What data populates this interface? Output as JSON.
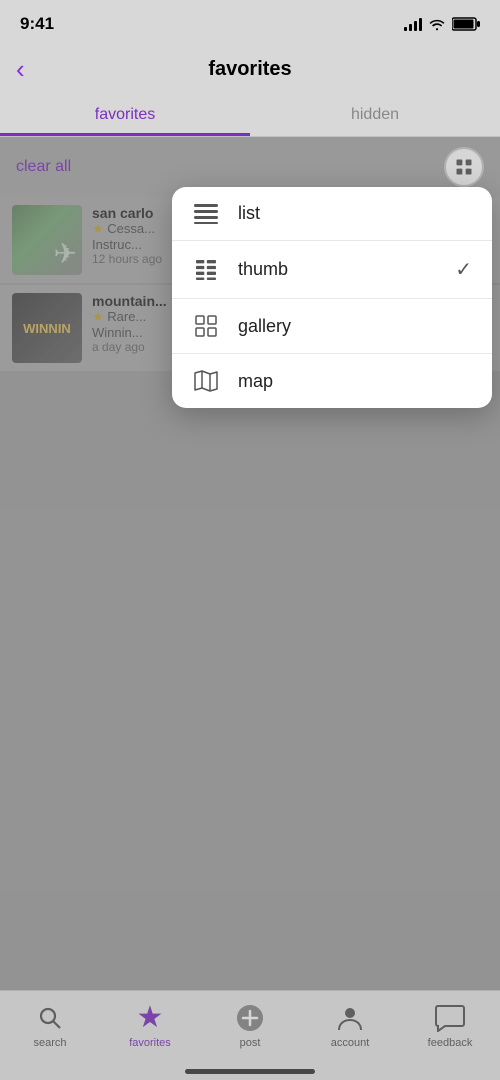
{
  "statusBar": {
    "time": "9:41"
  },
  "header": {
    "backLabel": "‹",
    "title": "favorites"
  },
  "tabs": [
    {
      "id": "favorites",
      "label": "favorites",
      "active": true
    },
    {
      "id": "hidden",
      "label": "hidden",
      "active": false
    }
  ],
  "toolbar": {
    "clearAllLabel": "clear all"
  },
  "listings": [
    {
      "id": 1,
      "title": "san carlo",
      "rating": "★",
      "subtitle": "Cessa...",
      "detail": "Instruc...",
      "time": "12 hours ago",
      "type": "plane"
    },
    {
      "id": 2,
      "title": "mountain...",
      "rating": "★",
      "subtitle": "Rare...",
      "detail": "Winnin...",
      "time": "a day ago",
      "type": "book"
    }
  ],
  "dropdownMenu": {
    "items": [
      {
        "id": "list",
        "label": "list",
        "icon": "list-icon",
        "checked": false
      },
      {
        "id": "thumb",
        "label": "thumb",
        "icon": "thumb-icon",
        "checked": true
      },
      {
        "id": "gallery",
        "label": "gallery",
        "icon": "gallery-icon",
        "checked": false
      },
      {
        "id": "map",
        "label": "map",
        "icon": "map-icon",
        "checked": false
      }
    ]
  },
  "bottomNav": {
    "items": [
      {
        "id": "search",
        "label": "search",
        "active": false,
        "icon": "search-icon"
      },
      {
        "id": "favorites",
        "label": "favorites",
        "active": true,
        "icon": "star-icon"
      },
      {
        "id": "post",
        "label": "post",
        "active": false,
        "icon": "post-icon"
      },
      {
        "id": "account",
        "label": "account",
        "active": false,
        "icon": "account-icon"
      },
      {
        "id": "feedback",
        "label": "feedback",
        "active": false,
        "icon": "feedback-icon"
      }
    ]
  }
}
